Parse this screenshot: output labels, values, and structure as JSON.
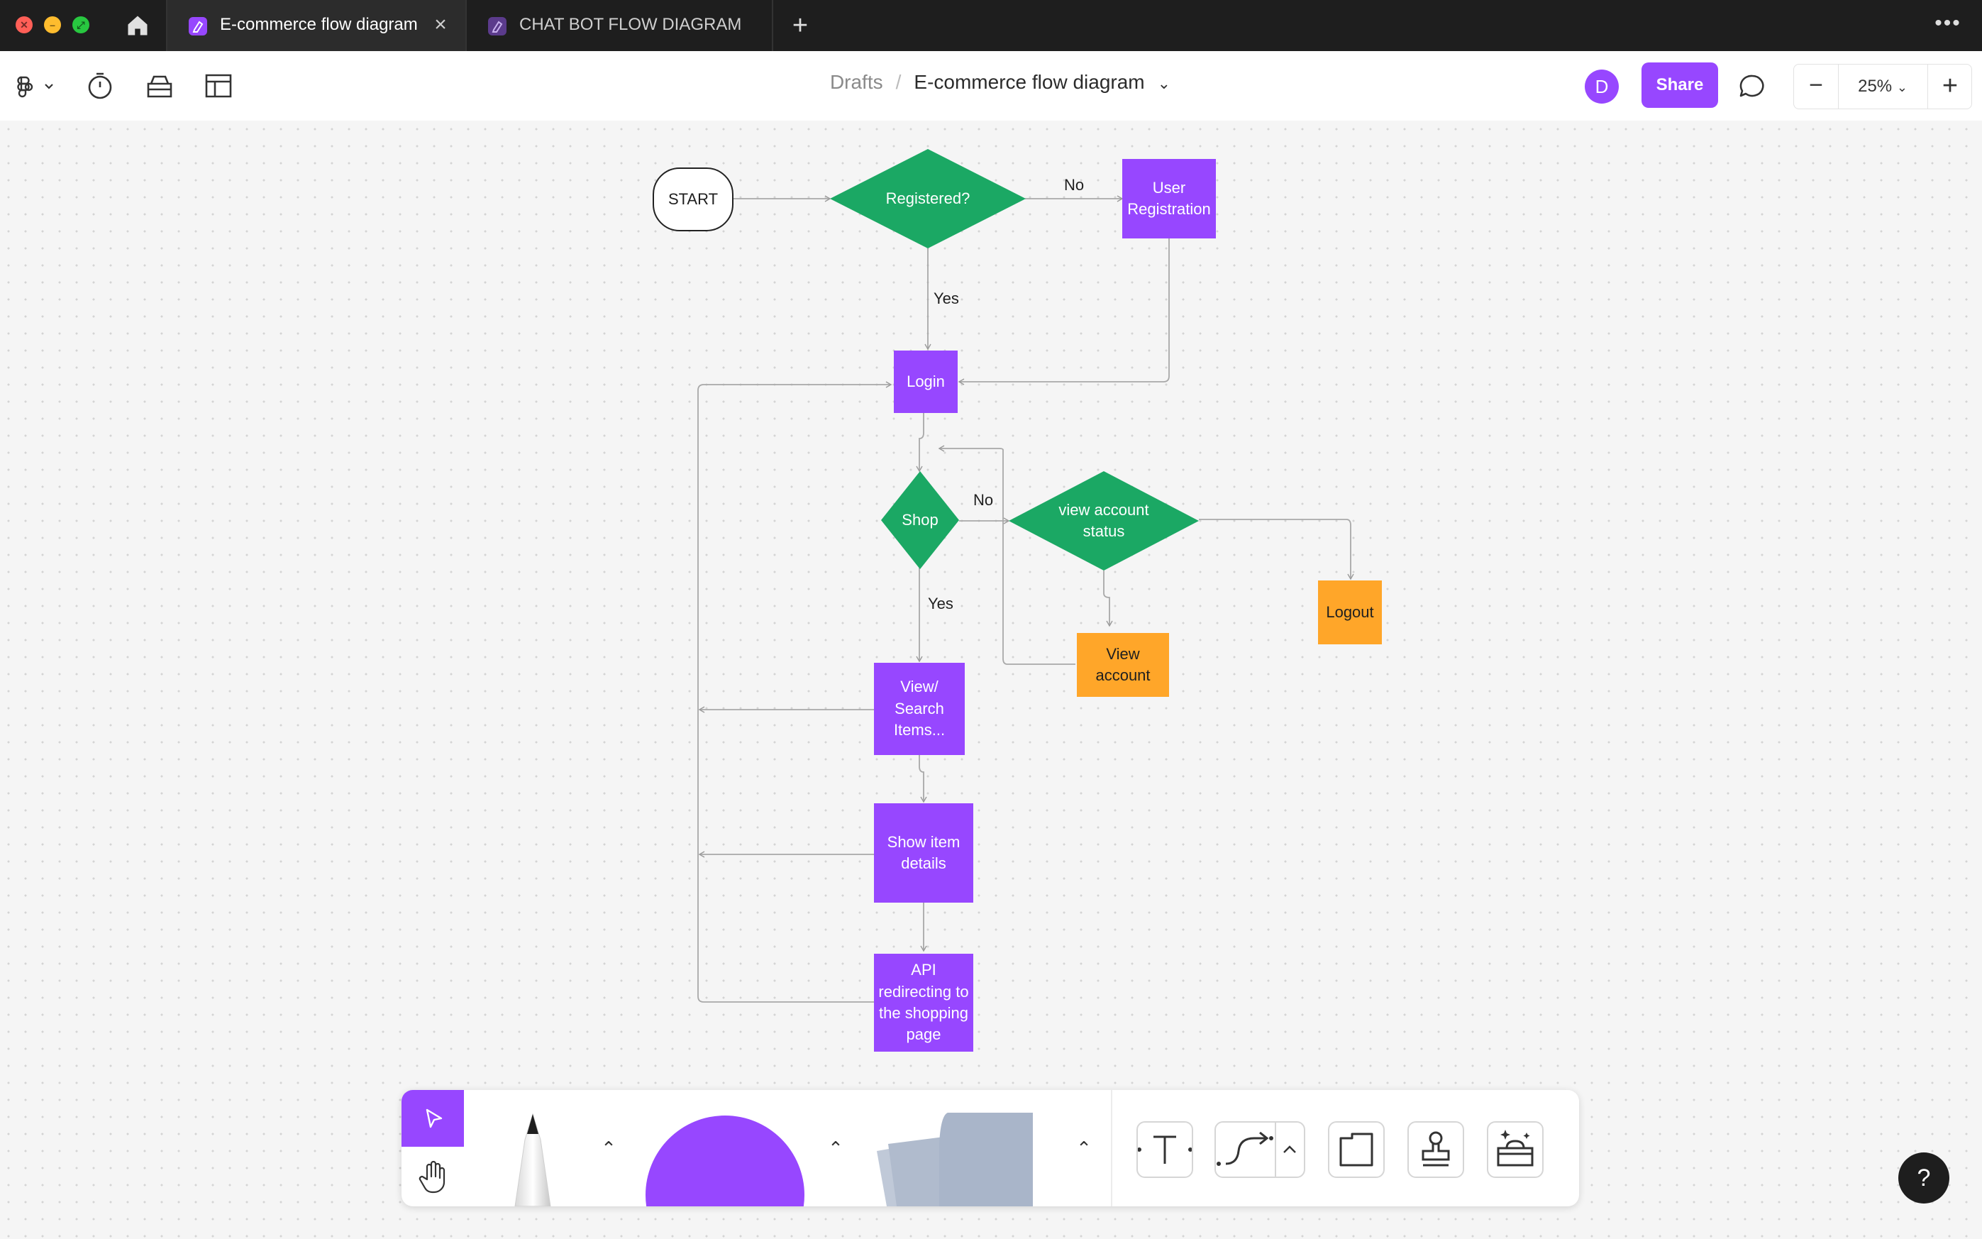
{
  "window": {
    "tabs": [
      {
        "label": "E-commerce flow diagram",
        "active": true
      },
      {
        "label": "CHAT BOT FLOW DIAGRAM",
        "active": false
      }
    ]
  },
  "toolbar": {
    "breadcrumb_parent": "Drafts",
    "breadcrumb_separator": "/",
    "file_title": "E-commerce flow diagram",
    "avatar_initial": "D",
    "share_label": "Share",
    "zoom_level": "25%"
  },
  "diagram": {
    "nodes": {
      "start": "START",
      "registered": "Registered?",
      "user_registration": "User Registration",
      "login": "Login",
      "shop": "Shop",
      "view_account_status": "view account status",
      "logout": "Logout",
      "view_account": "View account",
      "view_search": "View/ Search Items...",
      "show_item_details": "Show item details",
      "api_redirect": "API redirecting to the shopping page"
    },
    "edge_labels": {
      "registered_no": "No",
      "registered_yes": "Yes",
      "shop_no": "No",
      "shop_yes": "Yes"
    }
  },
  "colors": {
    "accent": "#9747ff",
    "decision_green": "#1ba864",
    "action_orange": "#ffa629",
    "titlebar": "#1e1e1e"
  },
  "icons": [
    "home-icon",
    "figma-logo-icon",
    "timer-icon",
    "widgets-icon",
    "layout-icon",
    "chevron-down-icon",
    "comment-icon",
    "minus-icon",
    "plus-icon",
    "cursor-icon",
    "hand-icon",
    "pen-icon",
    "shape-icon",
    "sticky-note-icon",
    "text-icon",
    "connector-icon",
    "section-icon",
    "stamp-icon",
    "more-tools-icon",
    "help-icon"
  ]
}
